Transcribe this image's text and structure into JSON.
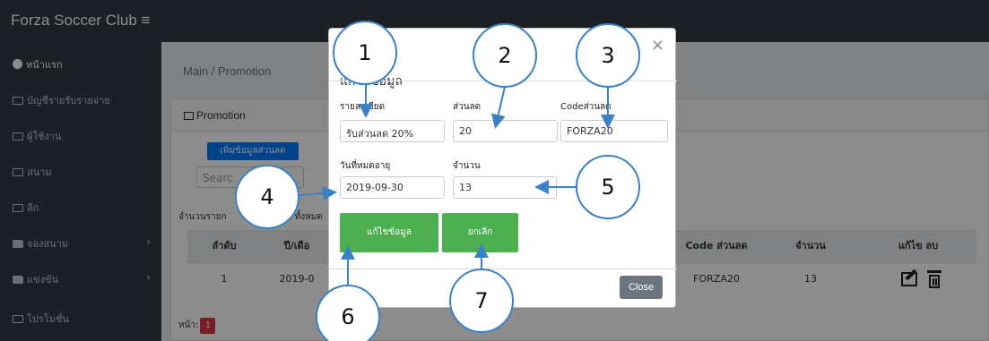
{
  "app": {
    "title": "Forza Soccer Club",
    "menu_icon": "≡"
  },
  "sidebar": {
    "items": [
      {
        "label": "หน้าแรก",
        "icon": "dashboard-icon",
        "chevron": ""
      },
      {
        "label": "บัญชีรายรับรายจ่าย",
        "icon": "table-icon",
        "chevron": ""
      },
      {
        "label": "ผู้ใช้งาน",
        "icon": "table-icon",
        "chevron": ""
      },
      {
        "label": "สนาม",
        "icon": "table-icon",
        "chevron": ""
      },
      {
        "label": "ลีก",
        "icon": "table-icon",
        "chevron": ""
      },
      {
        "label": "จองสนาม",
        "icon": "folder-icon",
        "chevron": "›"
      },
      {
        "label": "แข่งขัน",
        "icon": "folder-icon",
        "chevron": "›"
      },
      {
        "label": "โปรโมชั่น",
        "icon": "table-icon",
        "chevron": ""
      }
    ]
  },
  "breadcrumb": {
    "text": "Main / Promotion"
  },
  "card": {
    "header": "Promotion",
    "add_button": "เพิ่มข้อมูลส่วนลด",
    "search_placeholder": "Searc",
    "count_prefix": "จำนวนรายก",
    "count_suffix": "ทั้งหมด"
  },
  "table": {
    "headers": {
      "order": "ลำดับ",
      "date": "ปี/เดือ",
      "code": "Code ส่วนลด",
      "qty": "จำนวน",
      "actions": "แก้ไข ลบ"
    },
    "rows": [
      {
        "order": "1",
        "date": "2019-0",
        "code": "FORZA20",
        "qty": "13"
      }
    ]
  },
  "pager": {
    "label": "หน้า:",
    "current": "1"
  },
  "modal": {
    "close_x": "×",
    "title": "แก้ไขข้อมูล",
    "fields": {
      "detail_label": "รายละเอียด",
      "detail_value": "รับส่วนลด 20%",
      "discount_label": "ส่วนลด",
      "discount_value": "20",
      "code_label": "Codeส่วนลด",
      "code_value": "FORZA20",
      "expiry_label": "วันที่หมดอายุ",
      "expiry_value": "2019-09-30",
      "qty_label": "จำนวน",
      "qty_value": "13"
    },
    "save_button": "แก้ไขข้อมูล",
    "cancel_button": "ยกเลิก",
    "close_button": "Close"
  },
  "callouts": [
    "1",
    "2",
    "3",
    "4",
    "5",
    "6",
    "7"
  ],
  "colors": {
    "navbar": "#343a40",
    "callout_border": "#3b82c4",
    "green_button": "#4caf50",
    "add_button": "#007bff",
    "page_badge": "#dc3545"
  }
}
